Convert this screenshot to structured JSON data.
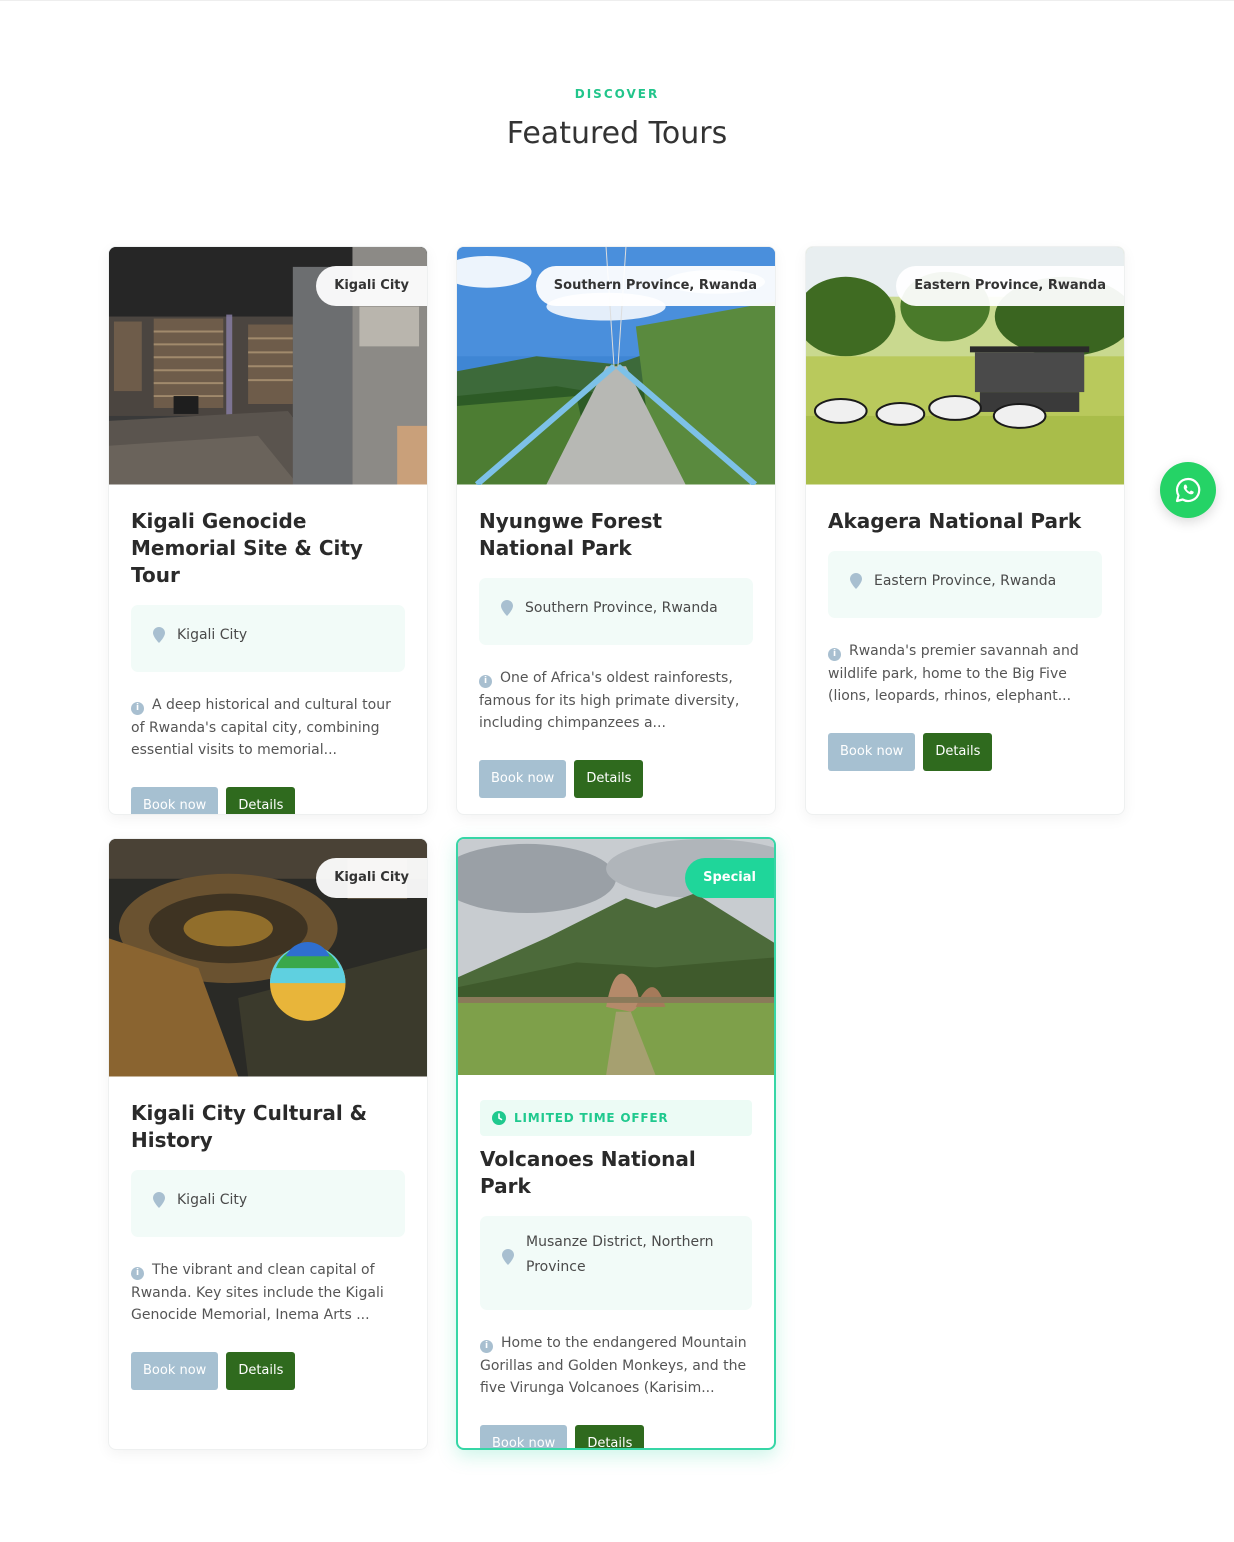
{
  "section": {
    "eyebrow": "DISCOVER",
    "title": "Featured Tours"
  },
  "buttons": {
    "book": "Book now",
    "details": "Details"
  },
  "tours": [
    {
      "title": "Kigali Genocide Memorial Site & City Tour",
      "tag": "Kigali City",
      "location": "Kigali City",
      "description": "A deep historical and cultural tour of Rwanda's capital city, combining essential visits to memorial..."
    },
    {
      "title": "Nyungwe Forest National Park",
      "tag": "Southern Province, Rwanda",
      "location": "Southern Province, Rwanda",
      "description": "One of Africa's oldest rainforests, famous for its high primate diversity, including chimpanzees a..."
    },
    {
      "title": "Akagera National Park",
      "tag": "Eastern Province, Rwanda",
      "location": "Eastern Province, Rwanda",
      "description": "Rwanda's premier savannah and wildlife park, home to the Big Five (lions, leopards, rhinos, elephant..."
    },
    {
      "title": "Kigali City Cultural & History",
      "tag": "Kigali City",
      "location": "Kigali City",
      "description": "The vibrant and clean capital of Rwanda. Key sites include the Kigali Genocide Memorial, Inema Arts ..."
    },
    {
      "title": "Volcanoes National Park",
      "tag": "Special",
      "offer": "LIMITED TIME OFFER",
      "location": "Musanze District, Northern Province",
      "description": "Home to the endangered Mountain Gorillas and Golden Monkeys, and the five Virunga Volcanoes (Karisim..."
    }
  ],
  "colors": {
    "accent": "#22c58b",
    "special_badge": "#1fd69a",
    "book_button": "#a6c0d1",
    "details_button": "#2f6a1e",
    "location_box": "#f2fbf8",
    "whatsapp": "#25d366"
  },
  "icons": {
    "location": "map-pin-icon",
    "info": "info-icon",
    "clock": "clock-icon",
    "chat": "whatsapp-icon"
  }
}
